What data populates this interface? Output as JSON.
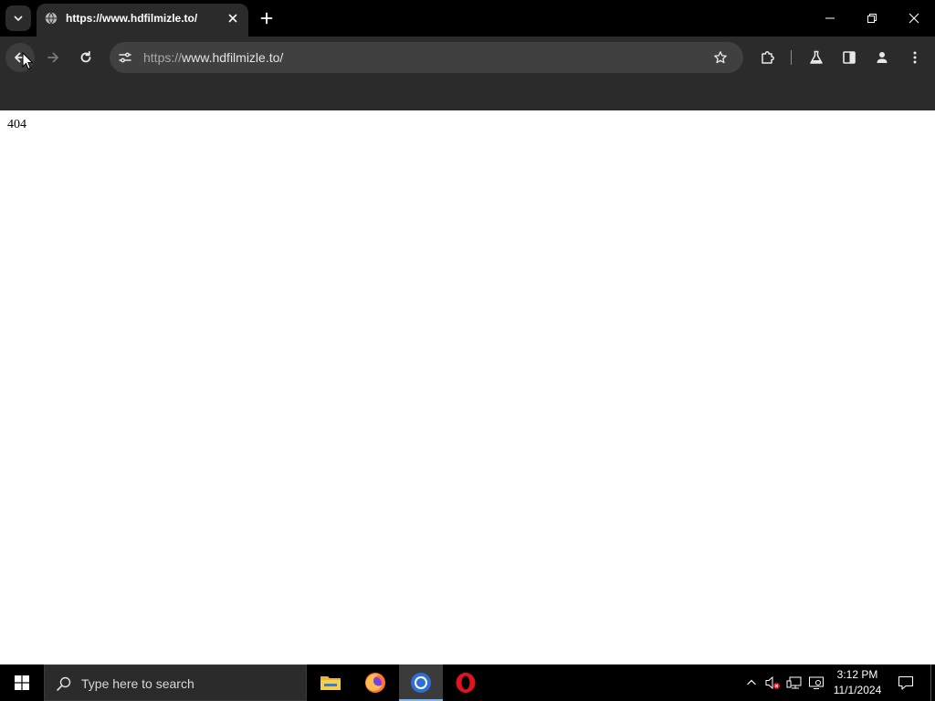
{
  "browser": {
    "tab": {
      "title": "https://www.hdfilmizle.to/"
    },
    "omnibox": {
      "scheme": "https://",
      "host_path": "www.hdfilmizle.to/"
    }
  },
  "page": {
    "body_text": "404"
  },
  "taskbar": {
    "search_placeholder": "Type here to search",
    "apps": [
      "file-explorer",
      "firefox",
      "chrome",
      "opera"
    ],
    "active_app": "chrome",
    "clock": {
      "time": "3:12 PM",
      "date": "11/1/2024"
    }
  },
  "colors": {
    "tab_strip": "#000000",
    "toolbar": "#2b2b2b",
    "omnibox": "#404040",
    "taskbar": "#000000",
    "active_indicator": "#7ab4f5"
  }
}
